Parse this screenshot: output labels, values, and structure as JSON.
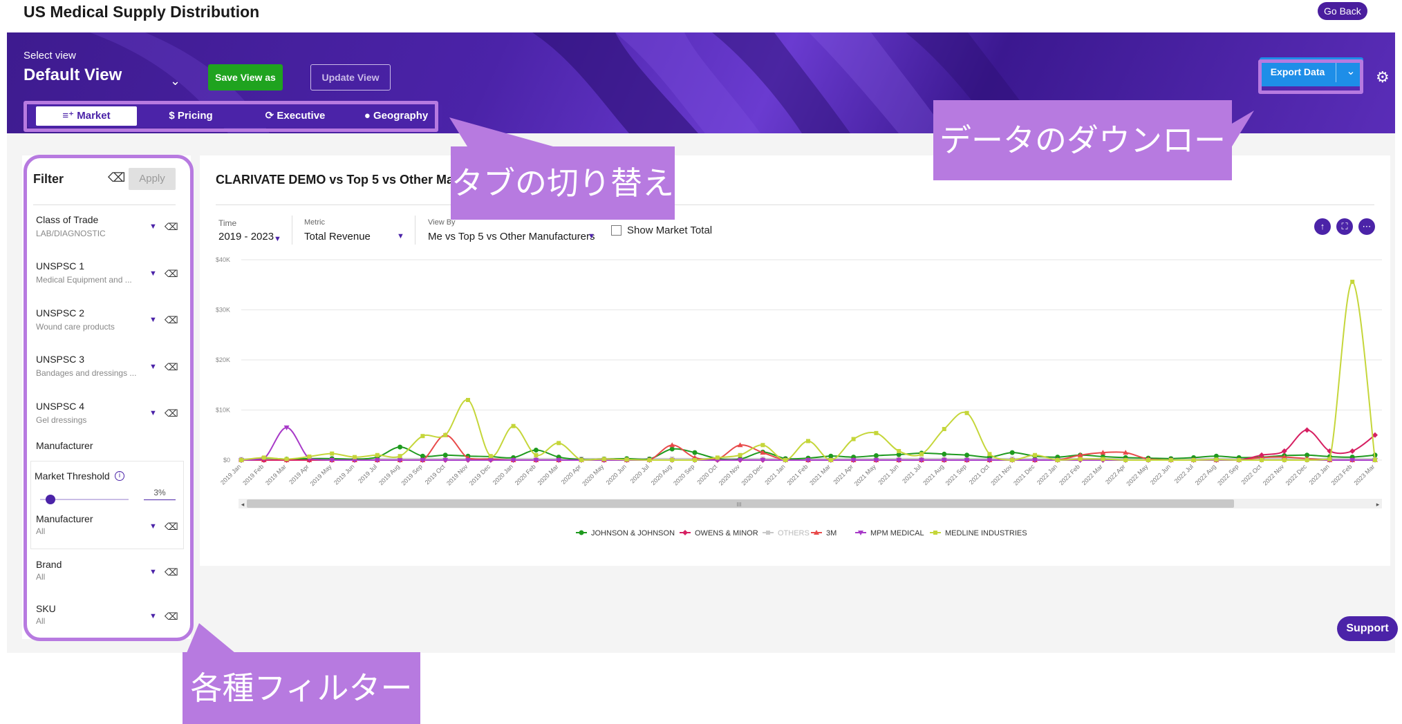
{
  "app": {
    "title": "US Medical Supply Distribution",
    "go_back": "Go Back"
  },
  "header": {
    "select_view_label": "Select view",
    "view_value": "Default View",
    "save_view_as": "Save View as",
    "update_view": "Update View",
    "export_data": "Export Data",
    "tabs": [
      {
        "label": "Market",
        "icon": "list-add-icon",
        "active": true
      },
      {
        "label": "Pricing",
        "icon": "dollar-icon",
        "active": false
      },
      {
        "label": "Executive",
        "icon": "refresh-icon",
        "active": false
      },
      {
        "label": "Geography",
        "icon": "map-pin-icon",
        "active": false
      }
    ]
  },
  "filter": {
    "title": "Filter",
    "apply": "Apply",
    "items": [
      {
        "label": "Class of Trade",
        "value": "LAB/DIAGNOSTIC"
      },
      {
        "label": "UNSPSC 1",
        "value": "Medical Equipment and ..."
      },
      {
        "label": "UNSPSC 2",
        "value": "Wound care products"
      },
      {
        "label": "UNSPSC 3",
        "value": "Bandages and dressings ..."
      },
      {
        "label": "UNSPSC 4",
        "value": "Gel dressings"
      }
    ],
    "manufacturer_section": "Manufacturer",
    "market_threshold_label": "Market Threshold",
    "market_threshold_value": "3%",
    "market_threshold_fraction": 0.03,
    "manufacturer": {
      "label": "Manufacturer",
      "value": "All"
    },
    "brand": {
      "label": "Brand",
      "value": "All"
    },
    "sku": {
      "label": "SKU",
      "value": "All"
    }
  },
  "chart_controls": {
    "time_label": "Time",
    "time_value": "2019 - 2023",
    "metric_label": "Metric",
    "metric_value": "Total Revenue",
    "viewby_label": "View By",
    "viewby_value": "Me vs Top 5 vs Other Manufacturers",
    "show_market_total": "Show Market Total"
  },
  "chart_data": {
    "type": "line",
    "title": "CLARIVATE DEMO vs Top 5 vs Other Man",
    "ylim": [
      0,
      40000
    ],
    "y_ticks": [
      "$40K",
      "$30K",
      "$20K",
      "$10K",
      "$0"
    ],
    "y_tick_values": [
      40000,
      30000,
      20000,
      10000,
      0
    ],
    "x": [
      "2019 Jan",
      "2019 Feb",
      "2019 Mar",
      "2019 Apr",
      "2019 May",
      "2019 Jun",
      "2019 Jul",
      "2019 Aug",
      "2019 Sep",
      "2019 Oct",
      "2019 Nov",
      "2019 Dec",
      "2020 Jan",
      "2020 Feb",
      "2020 Mar",
      "2020 Apr",
      "2020 May",
      "2020 Jun",
      "2020 Jul",
      "2020 Aug",
      "2020 Sep",
      "2020 Oct",
      "2020 Nov",
      "2020 Dec",
      "2021 Jan",
      "2021 Feb",
      "2021 Mar",
      "2021 Apr",
      "2021 May",
      "2021 Jun",
      "2021 Jul",
      "2021 Aug",
      "2021 Sep",
      "2021 Oct",
      "2021 Nov",
      "2021 Dec",
      "2022 Jan",
      "2022 Feb",
      "2022 Mar",
      "2022 Apr",
      "2022 May",
      "2022 Jun",
      "2022 Jul",
      "2022 Aug",
      "2022 Sep",
      "2022 Oct",
      "2022 Nov",
      "2022 Dec",
      "2023 Jan",
      "2023 Feb",
      "2023 Mar"
    ],
    "series": [
      {
        "name": "JOHNSON & JOHNSON",
        "color": "#1e9a1e",
        "marker": "circle",
        "values": [
          0,
          400,
          200,
          300,
          300,
          200,
          600,
          2600,
          800,
          1000,
          800,
          700,
          500,
          2000,
          600,
          100,
          200,
          300,
          200,
          2200,
          1500,
          300,
          200,
          1600,
          300,
          400,
          800,
          600,
          900,
          1100,
          1400,
          1200,
          1000,
          600,
          1500,
          800,
          600,
          1000,
          700,
          500,
          400,
          300,
          500,
          800,
          500,
          600,
          900,
          1000,
          700,
          600,
          1000
        ]
      },
      {
        "name": "OWENS & MINOR",
        "color": "#d62062",
        "marker": "diamond",
        "values": [
          0,
          0,
          0,
          0,
          0,
          0,
          0,
          0,
          0,
          0,
          0,
          0,
          0,
          0,
          0,
          0,
          0,
          0,
          0,
          0,
          0,
          0,
          0,
          0,
          0,
          0,
          0,
          0,
          0,
          0,
          0,
          0,
          0,
          0,
          0,
          0,
          0,
          0,
          0,
          0,
          0,
          0,
          0,
          0,
          0,
          1000,
          1800,
          6000,
          1800,
          1800,
          5000
        ]
      },
      {
        "name": "OTHERS",
        "color": "#c8c8c8",
        "marker": "square",
        "values": [
          200,
          300,
          200,
          300,
          300,
          200,
          300,
          300,
          300,
          300,
          300,
          300,
          300,
          300,
          300,
          300,
          300,
          300,
          300,
          300,
          300,
          300,
          300,
          300,
          300,
          300,
          300,
          300,
          300,
          300,
          300,
          300,
          300,
          300,
          300,
          300,
          300,
          300,
          300,
          300,
          300,
          300,
          300,
          300,
          300,
          300,
          300,
          300,
          300,
          300,
          300
        ]
      },
      {
        "name": "3M",
        "color": "#e84a4a",
        "marker": "triangle",
        "values": [
          0,
          0,
          0,
          0,
          0,
          0,
          0,
          0,
          0,
          5000,
          400,
          200,
          0,
          0,
          0,
          0,
          0,
          0,
          0,
          3000,
          500,
          200,
          3000,
          1500,
          0,
          0,
          0,
          0,
          0,
          0,
          0,
          0,
          0,
          0,
          0,
          0,
          0,
          1000,
          1500,
          1500,
          200,
          0,
          0,
          0,
          0,
          500,
          600,
          300,
          0,
          0,
          0
        ]
      },
      {
        "name": "MPM MEDICAL",
        "color": "#a83ac8",
        "marker": "tri-down",
        "values": [
          0,
          300,
          6500,
          300,
          0,
          0,
          0,
          0,
          0,
          0,
          0,
          0,
          0,
          0,
          0,
          0,
          0,
          0,
          0,
          0,
          0,
          0,
          0,
          0,
          0,
          0,
          0,
          0,
          0,
          0,
          0,
          0,
          0,
          0,
          0,
          0,
          0,
          0,
          0,
          0,
          0,
          0,
          0,
          0,
          0,
          0,
          0,
          0,
          0,
          0,
          0
        ]
      },
      {
        "name": "MEDLINE INDUSTRIES",
        "color": "#c5d63a",
        "marker": "square",
        "values": [
          0,
          500,
          200,
          700,
          1300,
          600,
          1000,
          800,
          4800,
          5000,
          12000,
          800,
          6800,
          1000,
          3400,
          0,
          200,
          100,
          0,
          0,
          0,
          500,
          1000,
          3000,
          0,
          3800,
          0,
          4200,
          5400,
          1800,
          1200,
          6200,
          9400,
          1200,
          0,
          1000,
          0,
          200,
          200,
          0,
          0,
          0,
          0,
          100,
          0,
          0,
          0,
          0,
          200,
          35600,
          0
        ]
      }
    ]
  },
  "annotations": {
    "tab_switch": "タブの切り替え",
    "download": "データのダウンロード",
    "filters": "各種フィルター"
  },
  "support": "Support"
}
